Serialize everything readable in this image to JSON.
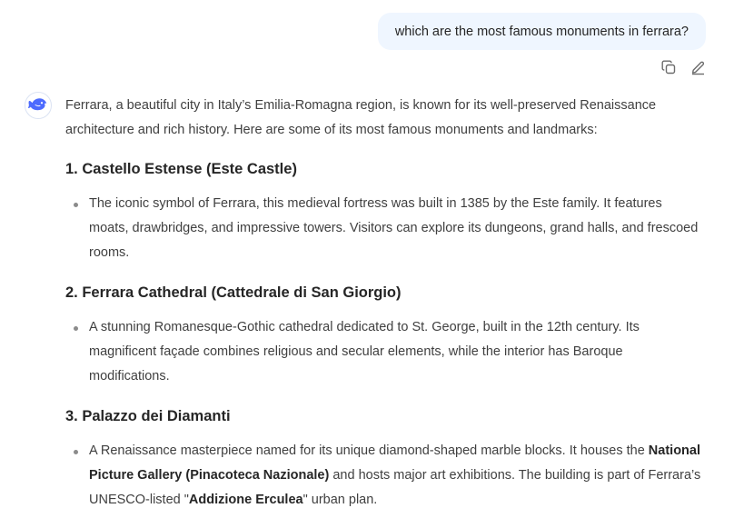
{
  "user_message": "which are the most famous monuments in ferrara?",
  "actions": {
    "copy_icon": "copy-icon",
    "edit_icon": "edit-icon"
  },
  "assistant": {
    "avatar_icon": "whale-logo-icon",
    "intro": "Ferrara, a beautiful city in Italy’s Emilia-Romagna region, is known for its well-preserved Renaissance architecture and rich history. Here are some of its most famous monuments and landmarks:",
    "sections": [
      {
        "heading": "1. Castello Estense (Este Castle)",
        "bullet": "The iconic symbol of Ferrara, this medieval fortress was built in 1385 by the Este family. It features moats, drawbridges, and impressive towers. Visitors can explore its dungeons, grand halls, and frescoed rooms."
      },
      {
        "heading": "2. Ferrara Cathedral (Cattedrale di San Giorgio)",
        "bullet": "A stunning Romanesque-Gothic cathedral dedicated to St. George, built in the 12th century. Its magnificent façade combines religious and secular elements, while the interior has Baroque modifications."
      },
      {
        "heading": "3. Palazzo dei Diamanti",
        "bullet_parts": {
          "p1": "A Renaissance masterpiece named for its unique diamond-shaped marble blocks. It houses the ",
          "b1": "National Picture Gallery (Pinacoteca Nazionale)",
          "p2": " and hosts major art exhibitions. The building is part of Ferrara’s UNESCO-listed \"",
          "b2": "Addizione Erculea",
          "p3": "\" urban plan."
        }
      }
    ]
  },
  "colors": {
    "user_bubble_bg": "#eff6ff",
    "text": "#404040",
    "heading": "#262626",
    "logo": "#4d6bfe"
  }
}
